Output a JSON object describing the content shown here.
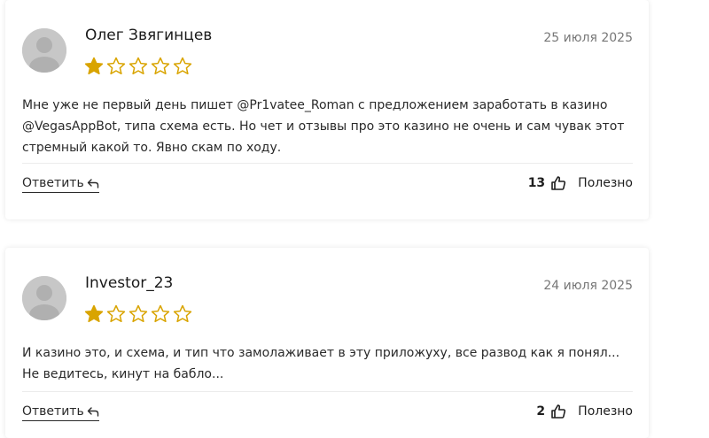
{
  "reviews": [
    {
      "author": "Олег Звягинцев",
      "date": "25 июля 2025",
      "rating": 1,
      "max_rating": 5,
      "text": "Мне уже не первый день пишет @Pr1vatee_Roman с предложением заработать в казино @VegasAppBot, типа схема есть. Но чет и отзывы про это казино не очень и сам чувак этот стремный какой то. Явно скам по ходу.",
      "reply_label": "Ответить",
      "likes": "13",
      "useful_label": "Полезно"
    },
    {
      "author": "Investor_23",
      "date": "24 июля 2025",
      "rating": 1,
      "max_rating": 5,
      "text": "И казино это, и схема, и тип что замолаживает в эту приложуху, все развод как я понял... Не ведитесь, кинут на бабло...",
      "reply_label": "Ответить",
      "likes": "2",
      "useful_label": "Полезно"
    }
  ],
  "colors": {
    "star": "#d9a400",
    "avatar_bg": "#c7c7c7",
    "date": "#777777"
  },
  "icons": {
    "avatar": "user-silhouette-icon",
    "star": "star-icon",
    "reply": "reply-arrow-icon",
    "like": "thumbs-up-icon"
  }
}
